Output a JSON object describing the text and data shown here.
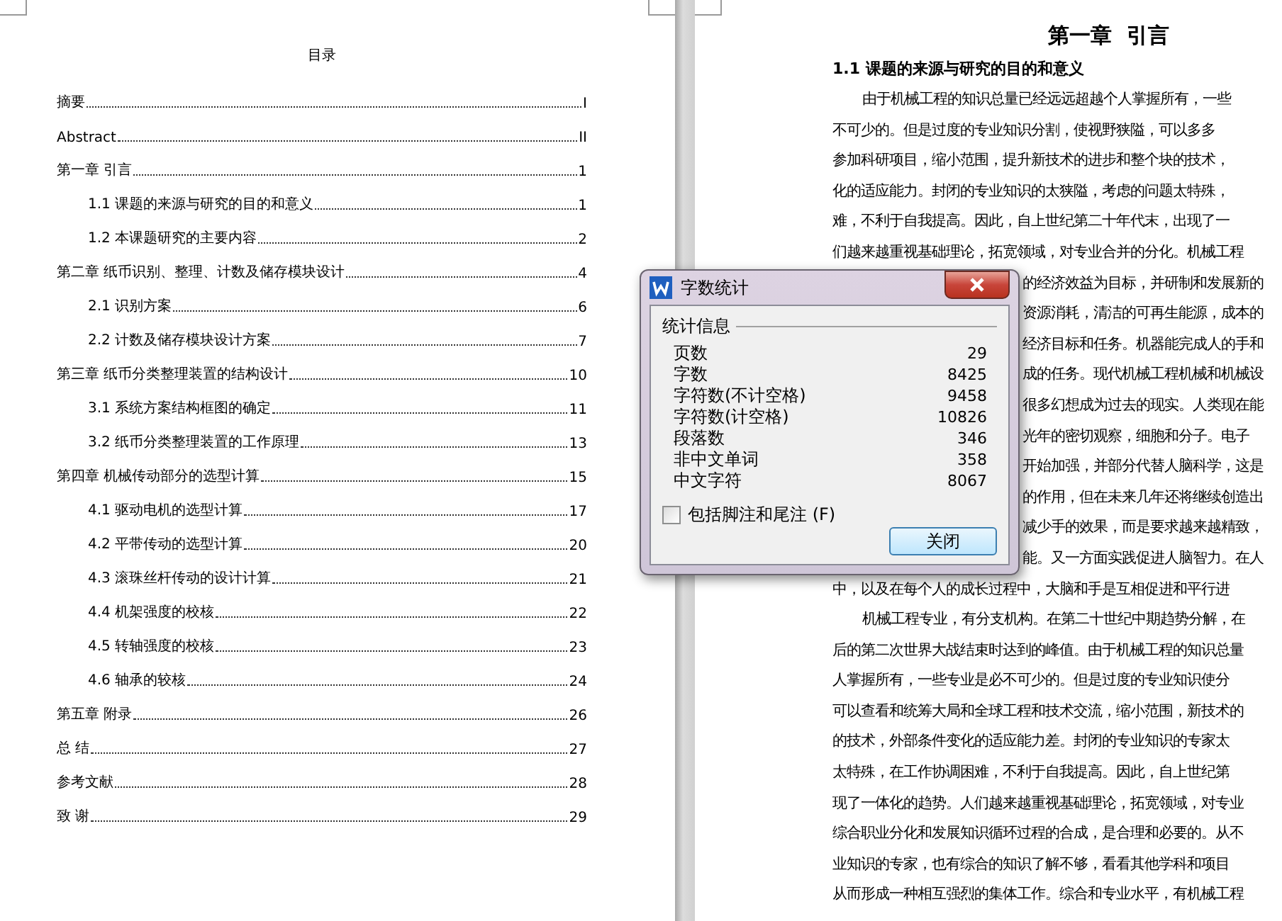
{
  "left_page": {
    "title": "目录",
    "entries": [
      {
        "text": "摘要",
        "page": "I"
      },
      {
        "text": "Abstract",
        "page": "II"
      },
      {
        "text": "第一章  引言",
        "page": "1",
        "children": [
          {
            "text": "1.1 课题的来源与研究的目的和意义",
            "page": "1"
          },
          {
            "text": "1.2 本课题研究的主要内容",
            "page": "2"
          }
        ]
      },
      {
        "text": "第二章  纸币识别、整理、计数及储存模块设计",
        "page": "4",
        "children": [
          {
            "text": "2.1 识别方案",
            "page": "6"
          },
          {
            "text": "2.2 计数及储存模块设计方案",
            "page": "7"
          }
        ]
      },
      {
        "text": "第三章  纸币分类整理装置的结构设计",
        "page": "10",
        "children": [
          {
            "text": "3.1 系统方案结构框图的确定",
            "page": "11"
          },
          {
            "text": "3.2 纸币分类整理装置的工作原理",
            "page": "13"
          }
        ]
      },
      {
        "text": "第四章  机械传动部分的选型计算",
        "page": "15",
        "children": [
          {
            "text": "4.1 驱动电机的选型计算",
            "page": "17"
          },
          {
            "text": "4.2 平带传动的选型计算",
            "page": "20"
          },
          {
            "text": "4.3 滚珠丝杆传动的设计计算",
            "page": "21"
          },
          {
            "text": "4.4 机架强度的校核",
            "page": "22"
          },
          {
            "text": "4.5 转轴强度的校核",
            "page": "23"
          },
          {
            "text": "4.6 轴承的较核",
            "page": "24"
          }
        ]
      },
      {
        "text": "第五章  附录",
        "page": "26"
      },
      {
        "text": "总  结",
        "page": "27"
      },
      {
        "text": "参考文献",
        "page": "28"
      },
      {
        "text": "致  谢",
        "page": "29"
      }
    ]
  },
  "right_page": {
    "chapter_title": "第一章  引言",
    "section_heading": "1.1 课题的来源与研究的目的和意义",
    "paragraphs": [
      {
        "lines": [
          {
            "text": "由于机械工程的知识总量已经远远超越个人掌握所有，一些",
            "partial": false
          },
          {
            "text": "不可少的。但是过度的专业知识分割，使视野狭隘，可以多多",
            "partial": false
          },
          {
            "text": "参加科研项目，缩小范围，提升新技术的进步和整个块的技术，",
            "partial": false
          },
          {
            "text": "化的适应能力。封闭的专业知识的太狭隘，考虑的问题太特殊，",
            "partial": false
          },
          {
            "text": "难，不利于自我提高。因此，自上世纪第二十年代末，出现了一",
            "partial": false
          },
          {
            "text": "们越来越重视基础理论，拓宽领域，对专业合并的分化。机械工程",
            "partial": false
          },
          {
            "text": "的经济效益为目标，并研制和发展新的",
            "partial": true
          },
          {
            "text": "资源消耗，清洁的可再生能源，成本的",
            "partial": true
          },
          {
            "text": "经济目标和任务。机器能完成人的手和",
            "partial": true
          },
          {
            "text": "成的任务。现代机械工程机械和机械设",
            "partial": true
          },
          {
            "text": "很多幻想成为过去的现实。人类现在能",
            "partial": true
          },
          {
            "text": "光年的密切观察，细胞和分子。电子",
            "partial": true
          },
          {
            "text": "开始加强，并部分代替人脑科学，这是",
            "partial": true
          },
          {
            "text": "的作用，但在未来几年还将继续创造出",
            "partial": true
          },
          {
            "text": "减少手的效果，而是要求越来越精致，",
            "partial": true
          },
          {
            "text": "能。又一方面实践促进人脑智力。在人",
            "partial": true
          },
          {
            "text": "中，以及在每个人的成长过程中，大脑和手是互相促进和平行进",
            "partial": false
          }
        ]
      },
      {
        "lines": [
          {
            "text": "机械工程专业，有分支机构。在第二十世纪中期趋势分解，在",
            "partial": false
          },
          {
            "text": "后的第二次世界大战结束时达到的峰值。由于机械工程的知识总量",
            "partial": false
          },
          {
            "text": "人掌握所有，一些专业是必不可少的。但是过度的专业知识使分",
            "partial": false
          },
          {
            "text": "可以查看和统筹大局和全球工程和技术交流，缩小范围，新技术的",
            "partial": false
          },
          {
            "text": "的技术，外部条件变化的适应能力差。封闭的专业知识的专家太",
            "partial": false
          },
          {
            "text": "太特殊，在工作协调困难，不利于自我提高。因此，自上世纪第",
            "partial": false
          },
          {
            "text": "现了一体化的趋势。人们越来越重视基础理论，拓宽领域，对专业",
            "partial": false
          },
          {
            "text": "综合职业分化和发展知识循环过程的合成，是合理和必要的。从不",
            "partial": false
          },
          {
            "text": "业知识的专家，也有综合的知识了解不够，看看其他学科和项目",
            "partial": false
          },
          {
            "text": "从而形成一种相互强烈的集体工作。综合和专业水平，有机械工程",
            "partial": false
          }
        ]
      }
    ]
  },
  "dialog": {
    "title": "字数统计",
    "group_label": "统计信息",
    "stats": [
      {
        "label": "页数",
        "value": "29"
      },
      {
        "label": "字数",
        "value": "8425"
      },
      {
        "label": "字符数(不计空格)",
        "value": "9458"
      },
      {
        "label": "字符数(计空格)",
        "value": "10826"
      },
      {
        "label": "段落数",
        "value": "346"
      },
      {
        "label": "非中文单词",
        "value": "358"
      },
      {
        "label": "中文字符",
        "value": "8067"
      }
    ],
    "checkbox": {
      "label": "包括脚注和尾注 (F)",
      "checked": false
    },
    "close_button": "关闭"
  }
}
